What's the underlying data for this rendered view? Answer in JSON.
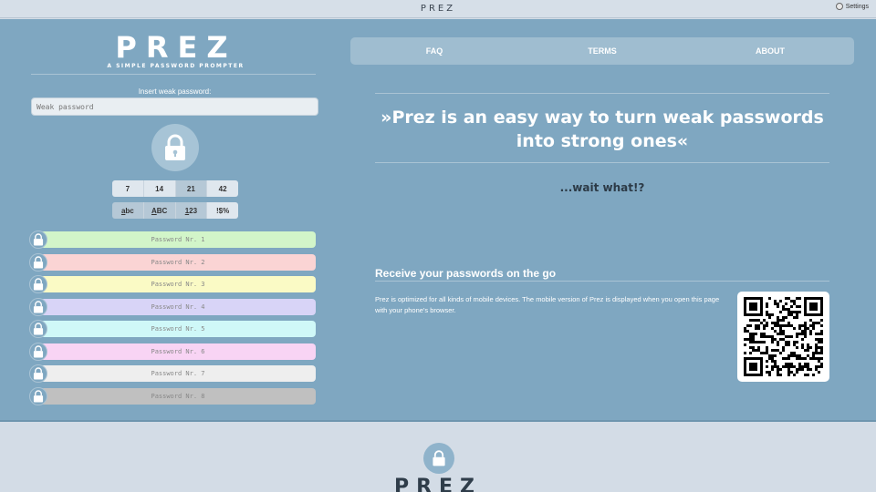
{
  "topbar": {
    "title": "PREZ",
    "settings_label": "Settings"
  },
  "logo": {
    "text": "PREZ",
    "tagline": "A SIMPLE PASSWORD PROMPTER"
  },
  "input": {
    "label": "Insert weak password:",
    "placeholder": "Weak password"
  },
  "lengths": {
    "options": [
      "7",
      "14",
      "21",
      "42"
    ],
    "selected": "21"
  },
  "charsets": {
    "options": [
      "abc",
      "ABC",
      "123",
      "!$%"
    ],
    "underline": [
      "a",
      "A",
      "1",
      ""
    ]
  },
  "passwords": [
    {
      "label": "Password Nr. 1",
      "color": "#d2f5c9"
    },
    {
      "label": "Password Nr. 2",
      "color": "#fad4d4"
    },
    {
      "label": "Password Nr. 3",
      "color": "#fafac5"
    },
    {
      "label": "Password Nr. 4",
      "color": "#d8d4f7"
    },
    {
      "label": "Password Nr. 5",
      "color": "#cff8f8"
    },
    {
      "label": "Password Nr. 6",
      "color": "#f8d4f4"
    },
    {
      "label": "Password Nr. 7",
      "color": "#eeeeee"
    },
    {
      "label": "Password Nr. 8",
      "color": "#c0c0c0"
    }
  ],
  "nav": {
    "faq": "FAQ",
    "terms": "TERMS",
    "about": "ABOUT"
  },
  "hero": {
    "headline_line1": "»Prez is an easy way to turn weak passwords",
    "headline_line2": "into strong ones«",
    "subtext": "...wait what!?"
  },
  "mobile": {
    "title": "Receive your passwords on the go",
    "text": "Prez is optimized for all kinds of mobile devices. The mobile version of Prez is displayed when you open this page with your phone's browser."
  },
  "footer": {
    "logo": "PREZ"
  },
  "colors": {
    "main_bg": "#7fa7c1",
    "nav_bg": "#9fbdd0",
    "page_bg": "#d3dce6"
  }
}
